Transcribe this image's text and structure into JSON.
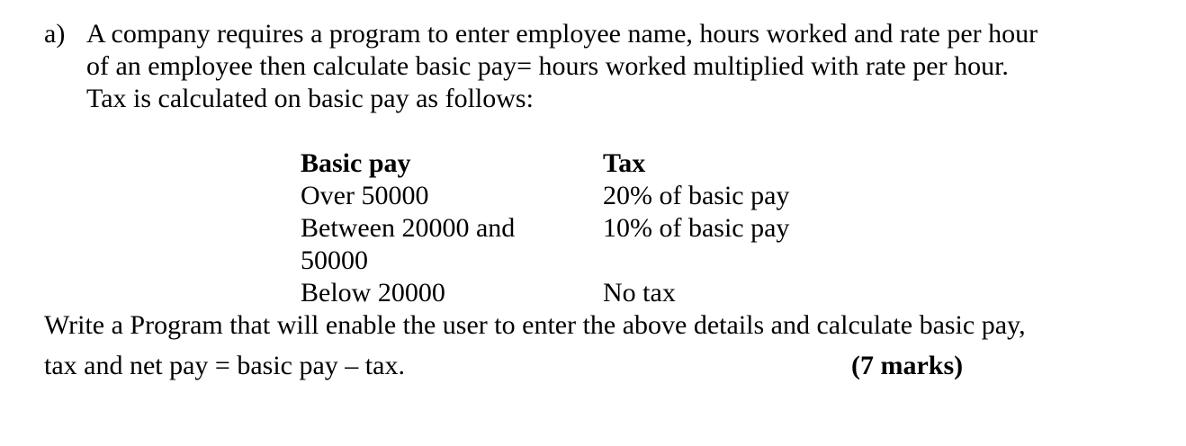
{
  "question": {
    "label": "a)",
    "intro_lines": [
      "A company requires a program to enter employee name, hours worked and rate per hour",
      "of an employee then calculate basic pay= hours worked multiplied with rate per hour.",
      "Tax is calculated on basic pay as follows:"
    ],
    "table": {
      "headers": [
        "Basic pay",
        "Tax"
      ],
      "rows": [
        [
          "Over 50000",
          "20% of basic pay"
        ],
        [
          "Between 20000 and 50000",
          "10% of basic pay"
        ],
        [
          "Below 20000",
          "No tax"
        ]
      ]
    },
    "task_line_1": "Write a Program that will enable the user to enter the above details and calculate basic pay,",
    "task_line_2": "tax and net pay = basic pay – tax.",
    "marks": "(7 marks)"
  }
}
